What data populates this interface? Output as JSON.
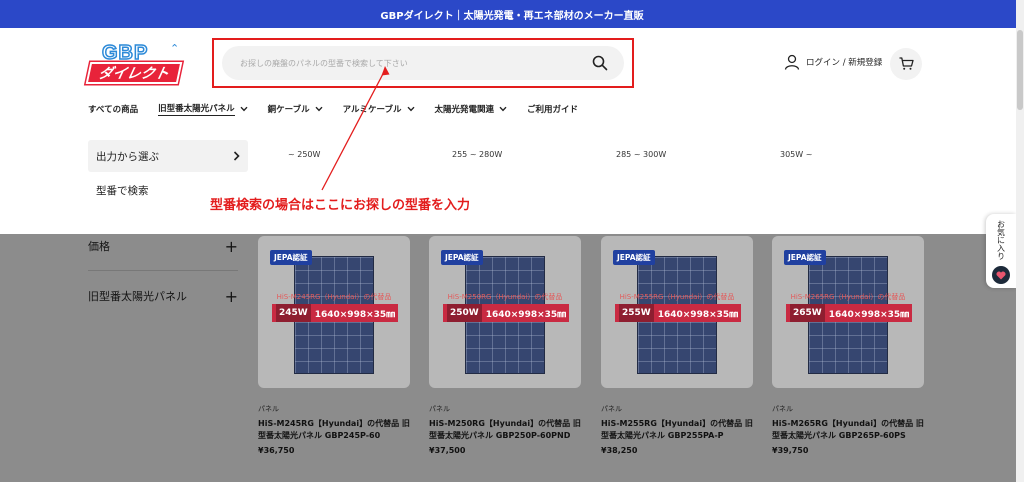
{
  "announcement": "GBPダイレクト｜太陽光発電・再エネ部材のメーカー直販",
  "logo": {
    "top": "GBP",
    "brand": "ダイレクト"
  },
  "search": {
    "placeholder": "お探しの廃盤のパネルの型番で検索して下さい"
  },
  "header": {
    "login_label": "ログイン / 新規登録"
  },
  "nav": [
    {
      "label": "すべての商品"
    },
    {
      "label": "旧型番太陽光パネル"
    },
    {
      "label": "銅ケーブル"
    },
    {
      "label": "アルミケーブル"
    },
    {
      "label": "太陽光発電関連"
    },
    {
      "label": "ご利用ガイド"
    }
  ],
  "dropdown": {
    "left": [
      "出力から選ぶ",
      "型番で検索"
    ],
    "options": [
      "~ 250W",
      "255 ~ 280W",
      "285 ~ 300W",
      "305W ~"
    ]
  },
  "annotation": "型番検索の場合はここにお探しの型番を入力",
  "filters": [
    "価格",
    "旧型番太陽光パネル"
  ],
  "products": [
    {
      "badge": "JEPA認証",
      "overlay_model": "HiS-M245RG（Hyundai）の代替品",
      "watt": "245W",
      "size": "1640×998×35㎜",
      "category": "パネル",
      "title": "HiS-M245RG【Hyundai】の代替品 旧型番太陽光パネル GBP245P-60",
      "price": "¥36,750"
    },
    {
      "badge": "JEPA認証",
      "overlay_model": "HiS-M250RG（Hyundai）の代替品",
      "watt": "250W",
      "size": "1640×998×35㎜",
      "category": "パネル",
      "title": "HiS-M250RG【Hyundai】の代替品 旧型番太陽光パネル GBP250P-60PND",
      "price": "¥37,500"
    },
    {
      "badge": "JEPA認証",
      "overlay_model": "HiS-M255RG（Hyundai）の代替品",
      "watt": "255W",
      "size": "1640×998×35㎜",
      "category": "パネル",
      "title": "HiS-M255RG【Hyundai】の代替品 旧型番太陽光パネル GBP255PA-P",
      "price": "¥38,250"
    },
    {
      "badge": "JEPA認証",
      "overlay_model": "HiS-M265RG（Hyundai）の代替品",
      "watt": "265W",
      "size": "1640×998×35㎜",
      "category": "パネル",
      "title": "HiS-M265RG【Hyundai】の代替品 旧型番太陽光パネル GBP265P-60PS",
      "price": "¥39,750"
    }
  ],
  "favorites": {
    "label": "お気に入り"
  },
  "colors": {
    "topbar": "#2b48c8",
    "highlight": "#e31d1d",
    "brand_red": "#e8233a",
    "logo_blue": "#2d8ad8"
  }
}
